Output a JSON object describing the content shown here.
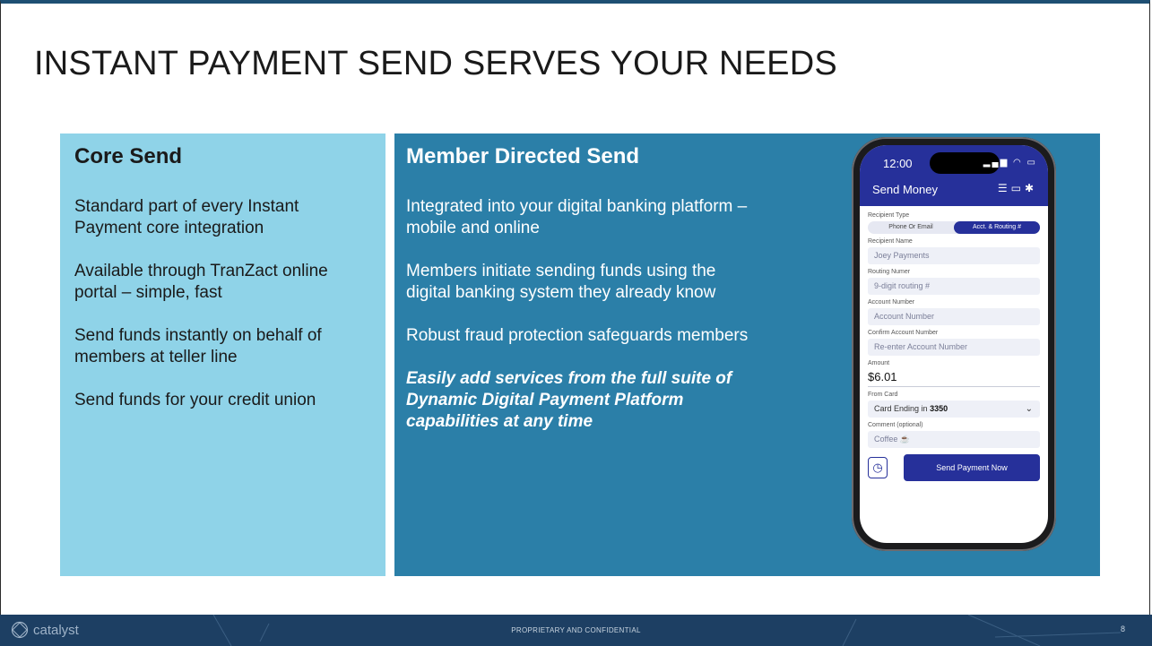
{
  "title": "INSTANT PAYMENT SEND SERVES YOUR NEEDS",
  "core": {
    "heading": "Core Send",
    "items": [
      "Standard part of every Instant Payment core integration",
      "Available through TranZact online portal – simple, fast",
      "Send funds instantly on behalf of members at teller line",
      "Send funds for your credit union"
    ]
  },
  "member": {
    "heading": "Member Directed Send",
    "items": [
      "Integrated into your digital banking platform – mobile and online",
      "Members initiate sending funds using the digital banking system they already know",
      "Robust fraud protection safeguards members"
    ],
    "emphasis": "Easily add services from the full suite of Dynamic Digital Payment Platform capabilities at any time"
  },
  "phone": {
    "time": "12:00",
    "app_title": "Send Money",
    "recipient_type_label": "Recipient Type",
    "toggle_options": [
      "Phone Or Email",
      "Acct. & Routing #"
    ],
    "recipient_name_label": "Recipient Name",
    "recipient_name_value": "Joey Payments",
    "routing_label": "Routing Numer",
    "routing_placeholder": "9-digit routing #",
    "account_label": "Account Number",
    "account_placeholder": "Account Number",
    "confirm_label": "Confirm Account Number",
    "confirm_placeholder": "Re-enter Account Number",
    "amount_label": "Amount",
    "amount_value": "$6.01",
    "from_card_label": "From Card",
    "card_prefix": "Card Ending in",
    "card_digits": "3350",
    "comment_label": "Comment (optional)",
    "comment_value": "Coffee ☕",
    "send_button": "Send Payment Now"
  },
  "footer": {
    "brand": "catalyst",
    "confidential": "PROPRIETARY AND CONFIDENTIAL",
    "page_number": "8"
  },
  "colors": {
    "core_panel": "#8fd3e8",
    "member_panel": "#2b7fa8",
    "app_accent": "#26309a",
    "footer": "#1d3f63"
  }
}
